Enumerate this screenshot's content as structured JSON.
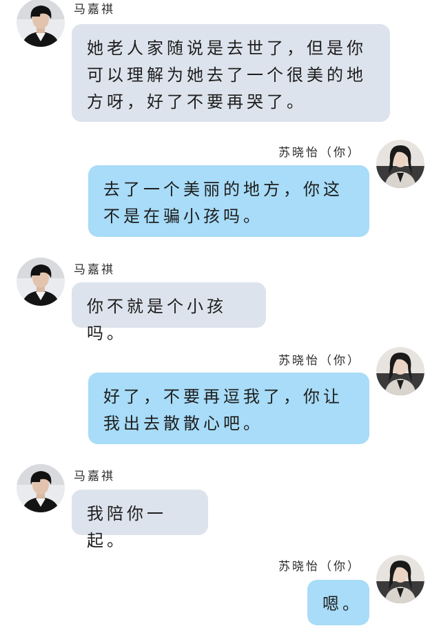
{
  "chat": {
    "messages": [
      {
        "sender": "马嘉祺",
        "side": "left",
        "text": "她老人家随说是去世了，但是你可以理解为她去了一个很美的地方呀，好了不要再哭了。"
      },
      {
        "sender": "苏晓怡（你）",
        "side": "right",
        "text": "去了一个美丽的地方，你这不是在骗小孩吗。"
      },
      {
        "sender": "马嘉祺",
        "side": "left",
        "text": "你不就是个小孩吗。"
      },
      {
        "sender": "苏晓怡（你）",
        "side": "right",
        "text": "好了，不要再逗我了，你让我出去散散心吧。"
      },
      {
        "sender": "马嘉祺",
        "side": "left",
        "text": "我陪你一起。"
      },
      {
        "sender": "苏晓怡（你）",
        "side": "right",
        "text": "嗯。"
      }
    ]
  },
  "colors": {
    "left_bubble": "#dde3ec",
    "right_bubble": "#a8dcf8"
  },
  "icons": {
    "left_avatar": "boy-portrait-avatar-icon",
    "right_avatar": "girl-portrait-avatar-icon"
  }
}
